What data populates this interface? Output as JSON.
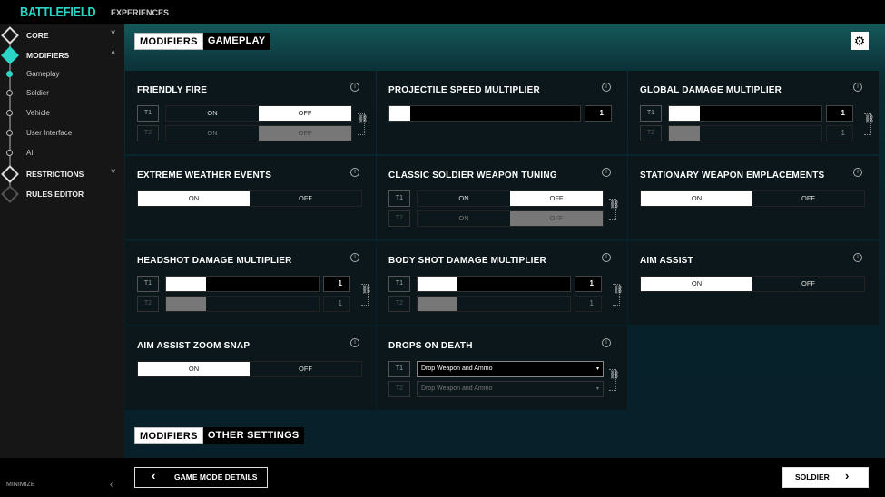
{
  "header": {
    "logo": "BATTLEFIELD",
    "nav": "EXPERIENCES"
  },
  "sidebar": {
    "items": [
      {
        "label": "CORE",
        "kind": "section",
        "chev": "˅",
        "icon": "core-icon"
      },
      {
        "label": "MODIFIERS",
        "kind": "section",
        "chev": "˄",
        "active": true,
        "icon": "modifiers-icon"
      },
      {
        "label": "Gameplay",
        "kind": "sub",
        "active": true
      },
      {
        "label": "Soldier",
        "kind": "sub"
      },
      {
        "label": "Vehicle",
        "kind": "sub"
      },
      {
        "label": "User Interface",
        "kind": "sub"
      },
      {
        "label": "AI",
        "kind": "sub"
      },
      {
        "label": "RESTRICTIONS",
        "kind": "section",
        "chev": "˅",
        "icon": "restrictions-icon"
      },
      {
        "label": "RULES EDITOR",
        "kind": "section",
        "dim": true,
        "icon": "rules-editor-icon"
      }
    ],
    "minimize": "MINIMIZE",
    "minimize_chev": "‹"
  },
  "section1": {
    "a": "MODIFIERS",
    "b": "GAMEPLAY"
  },
  "section2": {
    "a": "MODIFIERS",
    "b": "OTHER SETTINGS"
  },
  "gear": "⚙",
  "labels": {
    "t1": "T1",
    "t2": "T2",
    "on": "ON",
    "off": "OFF",
    "info": "i",
    "link": "⛓",
    "caret": "▾"
  },
  "panels": [
    {
      "title": "FRIENDLY FIRE",
      "type": "toggle-team",
      "t1": "OFF",
      "t2": "OFF"
    },
    {
      "title": "PROJECTILE SPEED MULTIPLIER",
      "type": "slider",
      "fill": 0.11,
      "value": "1"
    },
    {
      "title": "GLOBAL DAMAGE MULTIPLIER",
      "type": "slider-team",
      "fill": 0.2,
      "value": "1",
      "value2": "1"
    },
    {
      "title": "EXTREME WEATHER EVENTS",
      "type": "toggle",
      "t1": "ON"
    },
    {
      "title": "CLASSIC SOLDIER WEAPON TUNING",
      "type": "toggle-team",
      "t1": "OFF",
      "t2": "OFF"
    },
    {
      "title": "STATIONARY WEAPON EMPLACEMENTS",
      "type": "toggle",
      "t1": "ON"
    },
    {
      "title": "HEADSHOT DAMAGE MULTIPLIER",
      "type": "slider-team",
      "fill": 0.26,
      "value": "1",
      "value2": "1"
    },
    {
      "title": "BODY SHOT DAMAGE MULTIPLIER",
      "type": "slider-team",
      "fill": 0.26,
      "value": "1",
      "value2": "1"
    },
    {
      "title": "AIM ASSIST",
      "type": "toggle",
      "t1": "ON"
    },
    {
      "title": "AIM ASSIST ZOOM SNAP",
      "type": "toggle",
      "t1": "ON"
    },
    {
      "title": "DROPS ON DEATH",
      "type": "dropdown-team",
      "value": "Drop Weapon and Ammo",
      "value2": "Drop Weapon and Ammo"
    }
  ],
  "footer": {
    "back": "GAME MODE DETAILS",
    "back_icon": "‹",
    "next": "SOLDIER",
    "next_icon": "›"
  }
}
